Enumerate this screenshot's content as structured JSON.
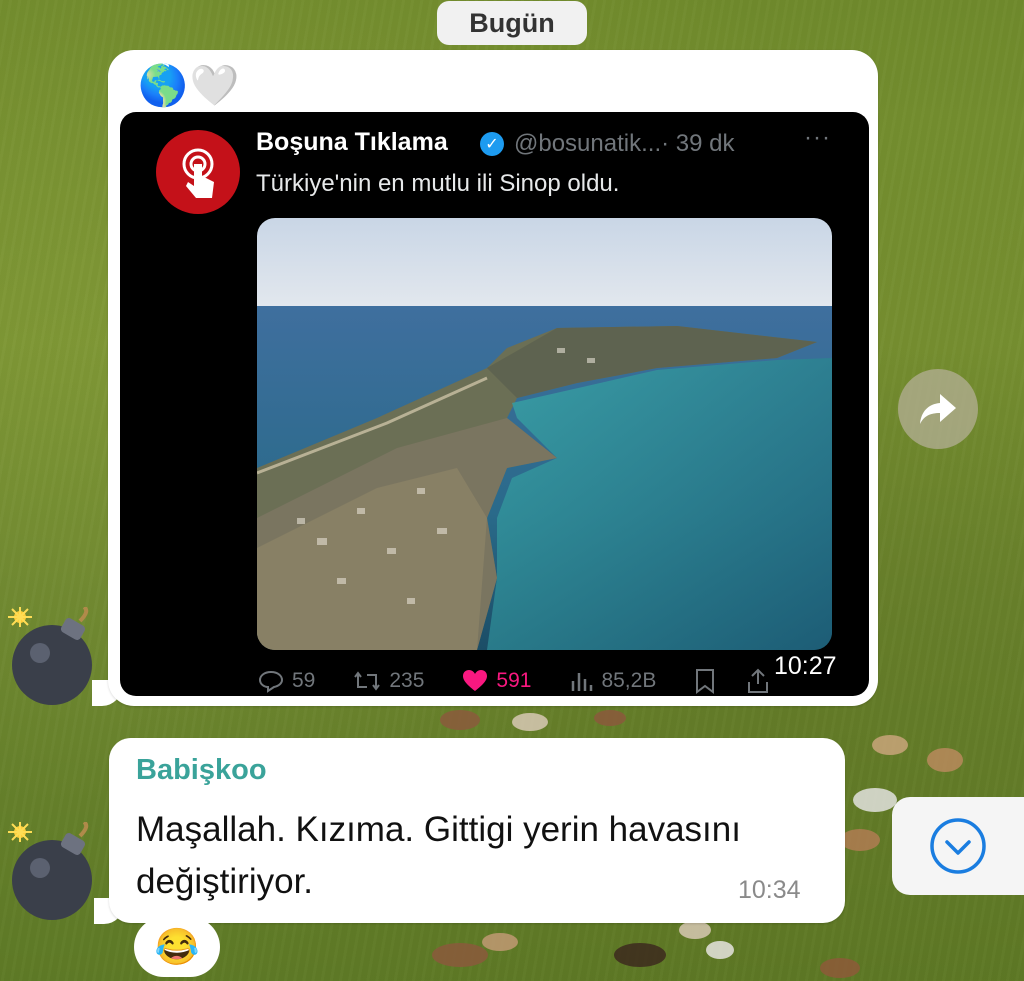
{
  "date_divider": "Bugün",
  "message1": {
    "reactions": [
      "🌎",
      "🤍"
    ],
    "tweet": {
      "author_name": "Boşuna Tıklama",
      "handle": "@bosunatik...",
      "time_ago": "· 39 dk",
      "more": "···",
      "text": "Türkiye'nin en mutlu ili Sinop oldu.",
      "stats": {
        "replies": "59",
        "retweets": "235",
        "likes": "591",
        "views": "85,2B"
      }
    },
    "timestamp": "10:27"
  },
  "message2": {
    "sender": "Babişkoo",
    "text": "Maşallah.  Kızıma. Gittigi yerin havasını değiştiriyor.",
    "timestamp": "10:34",
    "reaction": "😂"
  },
  "colors": {
    "sender_name": "#3aa39a",
    "tweet_like": "#f91880",
    "verified": "#1d9bf0",
    "avatar_bg": "#c41119"
  },
  "icons": [
    "bomb-avatar-icon",
    "share-forward-icon",
    "scroll-down-icon",
    "reply-icon",
    "retweet-icon",
    "heart-icon",
    "views-icon",
    "bookmark-icon",
    "share-icon",
    "verified-badge-icon"
  ]
}
